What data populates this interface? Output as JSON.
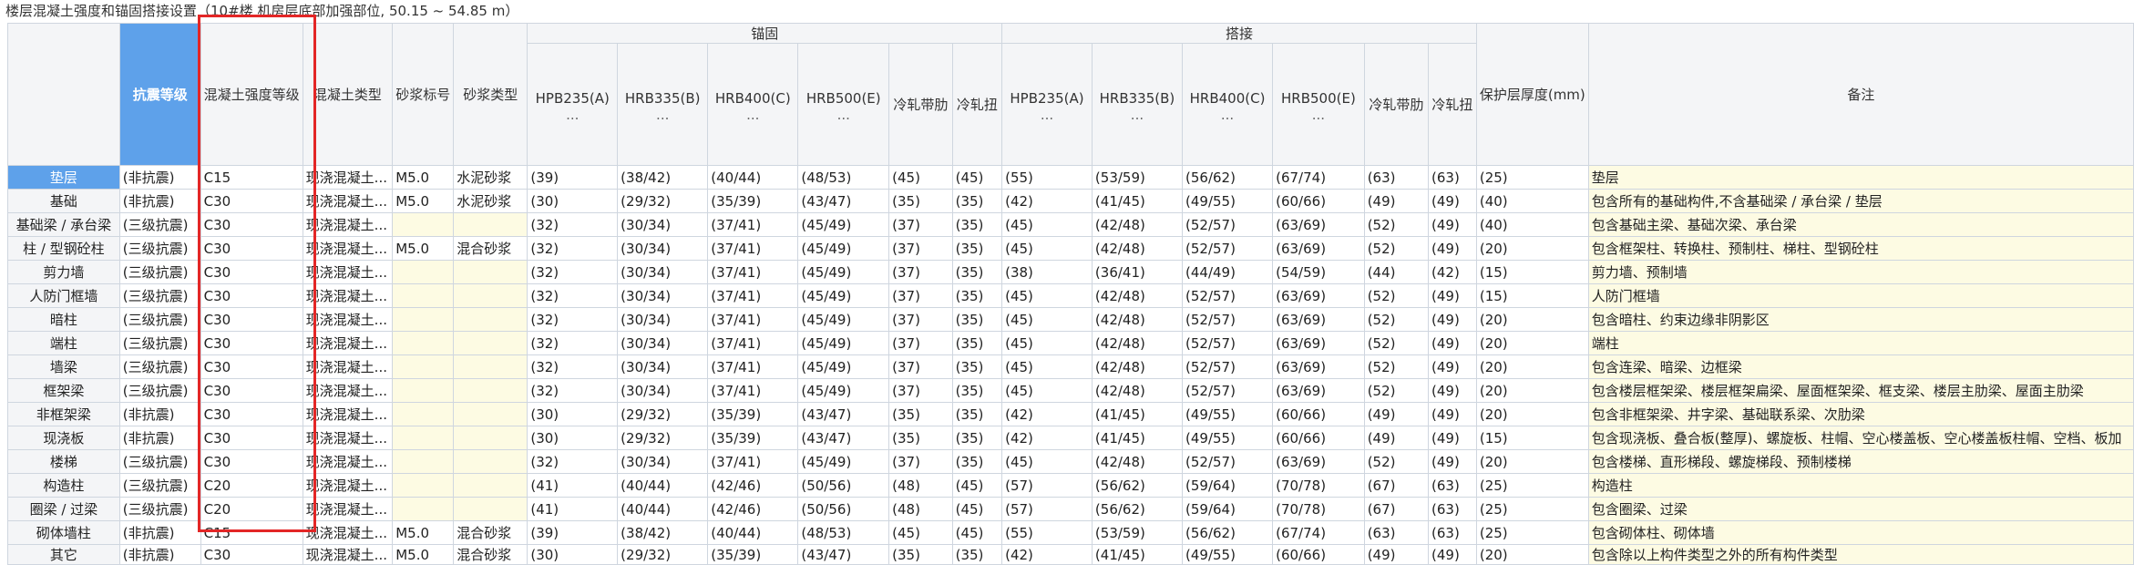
{
  "title": "楼层混凝土强度和锚固搭接设置（10#楼 机房层底部加强部位, 50.15 ~ 54.85 m）",
  "colors": {
    "header_blue": "#5ea1ea",
    "note_yellow": "#fdfbe3",
    "highlight_red": "#e32626"
  },
  "headers": {
    "seismic": "抗震等级",
    "concrete_grade": "混凝土强度等级",
    "concrete_type": "混凝土类型",
    "mortar_grade": "砂浆标号",
    "mortar_type": "砂浆类型",
    "anchor_group": "锚固",
    "lap_group": "搭接",
    "cover": "保护层厚度(mm)",
    "remark": "备注",
    "anchor_cols": [
      "HPB235(A)",
      "HRB335(B)",
      "HRB400(C)",
      "HRB500(E)",
      "冷轧带肋",
      "冷轧扭"
    ],
    "lap_cols": [
      "HPB235(A)",
      "HRB335(B)",
      "HRB400(C)",
      "HRB500(E)",
      "冷轧带肋",
      "冷轧扭"
    ],
    "ellipsis": "..."
  },
  "rows": [
    {
      "name": "垫层",
      "seismic": "(非抗震)",
      "grade": "C15",
      "ctype": "现浇混凝土...",
      "mgrade": "M5.0",
      "mtype": "水泥砂浆",
      "a1": "(39)",
      "a2": "(38/42)",
      "a3": "(40/44)",
      "a4": "(48/53)",
      "a5": "(45)",
      "a6": "(45)",
      "l1": "(55)",
      "l2": "(53/59)",
      "l3": "(56/62)",
      "l4": "(67/74)",
      "l5": "(63)",
      "l6": "(63)",
      "cover": "(25)",
      "remark": "垫层"
    },
    {
      "name": "基础",
      "seismic": "(非抗震)",
      "grade": "C30",
      "ctype": "现浇混凝土...",
      "mgrade": "M5.0",
      "mtype": "水泥砂浆",
      "a1": "(30)",
      "a2": "(29/32)",
      "a3": "(35/39)",
      "a4": "(43/47)",
      "a5": "(35)",
      "a6": "(35)",
      "l1": "(42)",
      "l2": "(41/45)",
      "l3": "(49/55)",
      "l4": "(60/66)",
      "l5": "(49)",
      "l6": "(49)",
      "cover": "(40)",
      "remark": "包含所有的基础构件,不含基础梁 / 承台梁 / 垫层"
    },
    {
      "name": "基础梁 / 承台梁",
      "seismic": "(三级抗震)",
      "grade": "C30",
      "ctype": "现浇混凝土...",
      "mgrade": "",
      "mtype": "",
      "a1": "(32)",
      "a2": "(30/34)",
      "a3": "(37/41)",
      "a4": "(45/49)",
      "a5": "(37)",
      "a6": "(35)",
      "l1": "(45)",
      "l2": "(42/48)",
      "l3": "(52/57)",
      "l4": "(63/69)",
      "l5": "(52)",
      "l6": "(49)",
      "cover": "(40)",
      "remark": "包含基础主梁、基础次梁、承台梁"
    },
    {
      "name": "柱 / 型钢砼柱",
      "seismic": "(三级抗震)",
      "grade": "C30",
      "ctype": "现浇混凝土...",
      "mgrade": "M5.0",
      "mtype": "混合砂浆",
      "a1": "(32)",
      "a2": "(30/34)",
      "a3": "(37/41)",
      "a4": "(45/49)",
      "a5": "(37)",
      "a6": "(35)",
      "l1": "(45)",
      "l2": "(42/48)",
      "l3": "(52/57)",
      "l4": "(63/69)",
      "l5": "(52)",
      "l6": "(49)",
      "cover": "(20)",
      "remark": "包含框架柱、转换柱、预制柱、梯柱、型钢砼柱"
    },
    {
      "name": "剪力墙",
      "seismic": "(三级抗震)",
      "grade": "C30",
      "ctype": "现浇混凝土...",
      "mgrade": "",
      "mtype": "",
      "a1": "(32)",
      "a2": "(30/34)",
      "a3": "(37/41)",
      "a4": "(45/49)",
      "a5": "(37)",
      "a6": "(35)",
      "l1": "(38)",
      "l2": "(36/41)",
      "l3": "(44/49)",
      "l4": "(54/59)",
      "l5": "(44)",
      "l6": "(42)",
      "cover": "(15)",
      "remark": "剪力墙、预制墙"
    },
    {
      "name": "人防门框墙",
      "seismic": "(三级抗震)",
      "grade": "C30",
      "ctype": "现浇混凝土...",
      "mgrade": "",
      "mtype": "",
      "a1": "(32)",
      "a2": "(30/34)",
      "a3": "(37/41)",
      "a4": "(45/49)",
      "a5": "(37)",
      "a6": "(35)",
      "l1": "(45)",
      "l2": "(42/48)",
      "l3": "(52/57)",
      "l4": "(63/69)",
      "l5": "(52)",
      "l6": "(49)",
      "cover": "(15)",
      "remark": "人防门框墙"
    },
    {
      "name": "暗柱",
      "seismic": "(三级抗震)",
      "grade": "C30",
      "ctype": "现浇混凝土...",
      "mgrade": "",
      "mtype": "",
      "a1": "(32)",
      "a2": "(30/34)",
      "a3": "(37/41)",
      "a4": "(45/49)",
      "a5": "(37)",
      "a6": "(35)",
      "l1": "(45)",
      "l2": "(42/48)",
      "l3": "(52/57)",
      "l4": "(63/69)",
      "l5": "(52)",
      "l6": "(49)",
      "cover": "(20)",
      "remark": "包含暗柱、约束边缘非阴影区"
    },
    {
      "name": "端柱",
      "seismic": "(三级抗震)",
      "grade": "C30",
      "ctype": "现浇混凝土...",
      "mgrade": "",
      "mtype": "",
      "a1": "(32)",
      "a2": "(30/34)",
      "a3": "(37/41)",
      "a4": "(45/49)",
      "a5": "(37)",
      "a6": "(35)",
      "l1": "(45)",
      "l2": "(42/48)",
      "l3": "(52/57)",
      "l4": "(63/69)",
      "l5": "(52)",
      "l6": "(49)",
      "cover": "(20)",
      "remark": "端柱"
    },
    {
      "name": "墙梁",
      "seismic": "(三级抗震)",
      "grade": "C30",
      "ctype": "现浇混凝土...",
      "mgrade": "",
      "mtype": "",
      "a1": "(32)",
      "a2": "(30/34)",
      "a3": "(37/41)",
      "a4": "(45/49)",
      "a5": "(37)",
      "a6": "(35)",
      "l1": "(45)",
      "l2": "(42/48)",
      "l3": "(52/57)",
      "l4": "(63/69)",
      "l5": "(52)",
      "l6": "(49)",
      "cover": "(20)",
      "remark": "包含连梁、暗梁、边框梁"
    },
    {
      "name": "框架梁",
      "seismic": "(三级抗震)",
      "grade": "C30",
      "ctype": "现浇混凝土...",
      "mgrade": "",
      "mtype": "",
      "a1": "(32)",
      "a2": "(30/34)",
      "a3": "(37/41)",
      "a4": "(45/49)",
      "a5": "(37)",
      "a6": "(35)",
      "l1": "(45)",
      "l2": "(42/48)",
      "l3": "(52/57)",
      "l4": "(63/69)",
      "l5": "(52)",
      "l6": "(49)",
      "cover": "(20)",
      "remark": "包含楼层框架梁、楼层框架扁梁、屋面框架梁、框支梁、楼层主肋梁、屋面主肋梁"
    },
    {
      "name": "非框架梁",
      "seismic": "(非抗震)",
      "grade": "C30",
      "ctype": "现浇混凝土...",
      "mgrade": "",
      "mtype": "",
      "a1": "(30)",
      "a2": "(29/32)",
      "a3": "(35/39)",
      "a4": "(43/47)",
      "a5": "(35)",
      "a6": "(35)",
      "l1": "(42)",
      "l2": "(41/45)",
      "l3": "(49/55)",
      "l4": "(60/66)",
      "l5": "(49)",
      "l6": "(49)",
      "cover": "(20)",
      "remark": "包含非框架梁、井字梁、基础联系梁、次肋梁"
    },
    {
      "name": "现浇板",
      "seismic": "(非抗震)",
      "grade": "C30",
      "ctype": "现浇混凝土...",
      "mgrade": "",
      "mtype": "",
      "a1": "(30)",
      "a2": "(29/32)",
      "a3": "(35/39)",
      "a4": "(43/47)",
      "a5": "(35)",
      "a6": "(35)",
      "l1": "(42)",
      "l2": "(41/45)",
      "l3": "(49/55)",
      "l4": "(60/66)",
      "l5": "(49)",
      "l6": "(49)",
      "cover": "(15)",
      "remark": "包含现浇板、叠合板(整厚)、螺旋板、柱帽、空心楼盖板、空心楼盖板柱帽、空档、板加"
    },
    {
      "name": "楼梯",
      "seismic": "(三级抗震)",
      "grade": "C30",
      "ctype": "现浇混凝土...",
      "mgrade": "",
      "mtype": "",
      "a1": "(32)",
      "a2": "(30/34)",
      "a3": "(37/41)",
      "a4": "(45/49)",
      "a5": "(37)",
      "a6": "(35)",
      "l1": "(45)",
      "l2": "(42/48)",
      "l3": "(52/57)",
      "l4": "(63/69)",
      "l5": "(52)",
      "l6": "(49)",
      "cover": "(20)",
      "remark": "包含楼梯、直形梯段、螺旋梯段、预制楼梯"
    },
    {
      "name": "构造柱",
      "seismic": "(三级抗震)",
      "grade": "C20",
      "ctype": "现浇混凝土...",
      "mgrade": "",
      "mtype": "",
      "a1": "(41)",
      "a2": "(40/44)",
      "a3": "(42/46)",
      "a4": "(50/56)",
      "a5": "(48)",
      "a6": "(45)",
      "l1": "(57)",
      "l2": "(56/62)",
      "l3": "(59/64)",
      "l4": "(70/78)",
      "l5": "(67)",
      "l6": "(63)",
      "cover": "(25)",
      "remark": "构造柱"
    },
    {
      "name": "圈梁 / 过梁",
      "seismic": "(三级抗震)",
      "grade": "C20",
      "ctype": "现浇混凝土...",
      "mgrade": "",
      "mtype": "",
      "a1": "(41)",
      "a2": "(40/44)",
      "a3": "(42/46)",
      "a4": "(50/56)",
      "a5": "(48)",
      "a6": "(45)",
      "l1": "(57)",
      "l2": "(56/62)",
      "l3": "(59/64)",
      "l4": "(70/78)",
      "l5": "(67)",
      "l6": "(63)",
      "cover": "(25)",
      "remark": "包含圈梁、过梁"
    },
    {
      "name": "砌体墙柱",
      "seismic": "(非抗震)",
      "grade": "C15",
      "ctype": "现浇混凝土...",
      "mgrade": "M5.0",
      "mtype": "混合砂浆",
      "a1": "(39)",
      "a2": "(38/42)",
      "a3": "(40/44)",
      "a4": "(48/53)",
      "a5": "(45)",
      "a6": "(45)",
      "l1": "(55)",
      "l2": "(53/59)",
      "l3": "(56/62)",
      "l4": "(67/74)",
      "l5": "(63)",
      "l6": "(63)",
      "cover": "(25)",
      "remark": "包含砌体柱、砌体墙"
    },
    {
      "name": "其它",
      "seismic": "(非抗震)",
      "grade": "C30",
      "ctype": "现浇混凝土...",
      "mgrade": "M5.0",
      "mtype": "混合砂浆",
      "a1": "(30)",
      "a2": "(29/32)",
      "a3": "(35/39)",
      "a4": "(43/47)",
      "a5": "(35)",
      "a6": "(35)",
      "l1": "(42)",
      "l2": "(41/45)",
      "l3": "(49/55)",
      "l4": "(60/66)",
      "l5": "(49)",
      "l6": "(49)",
      "cover": "(20)",
      "remark": "包含除以上构件类型之外的所有构件类型"
    }
  ]
}
